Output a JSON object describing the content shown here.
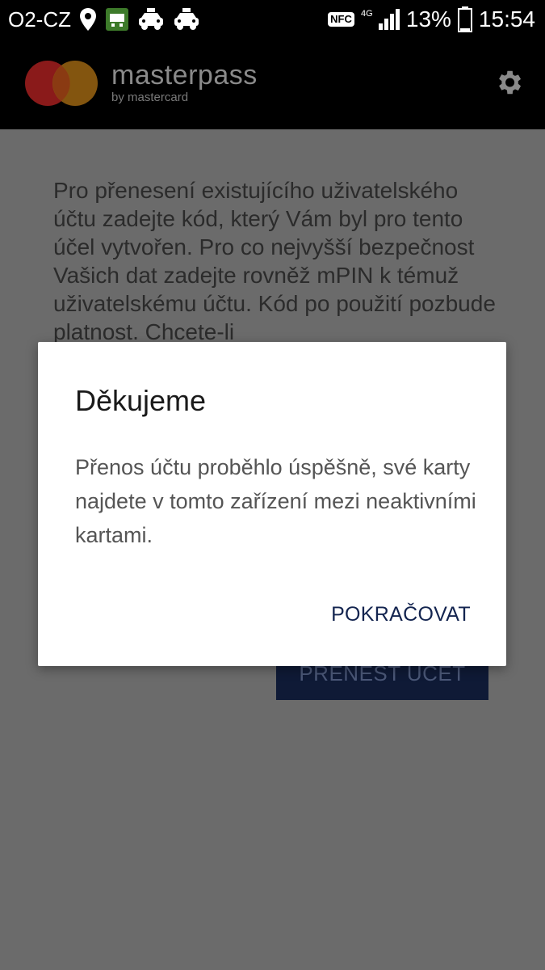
{
  "status_bar": {
    "carrier": "O2-CZ",
    "nfc": "NFC",
    "network": "4G",
    "battery": "13%",
    "time": "15:54",
    "icons": [
      "location-pin-icon",
      "game-icon",
      "taxi-icon",
      "taxi-icon",
      "nfc-icon",
      "signal-icon",
      "battery-icon"
    ]
  },
  "app_bar": {
    "brand_name": "masterpass",
    "brand_sub": "by mastercard",
    "icon": "gear-icon",
    "colors": {
      "left_circle": "#8a1a1a",
      "right_circle": "#8a5a10"
    }
  },
  "content": {
    "intro": "Pro přenesení existujícího uživatelského účtu zadejte kód, který Vám byl pro tento účel vytvořen. Pro co nejvyšší bezpečnost Vašich dat zadejte rovněž mPIN k témuž uživatelskému účtu. Kód po použití pozbude platnost. Chcete-li",
    "transfer_button": "PŘENÉST ÚČET"
  },
  "dialog": {
    "title": "Děkujeme",
    "message": "Přenos účtu proběhlo úspěšně, své karty najdete v tomto zařízení mezi neaktivními kartami.",
    "action": "POKRAČOVAT"
  }
}
